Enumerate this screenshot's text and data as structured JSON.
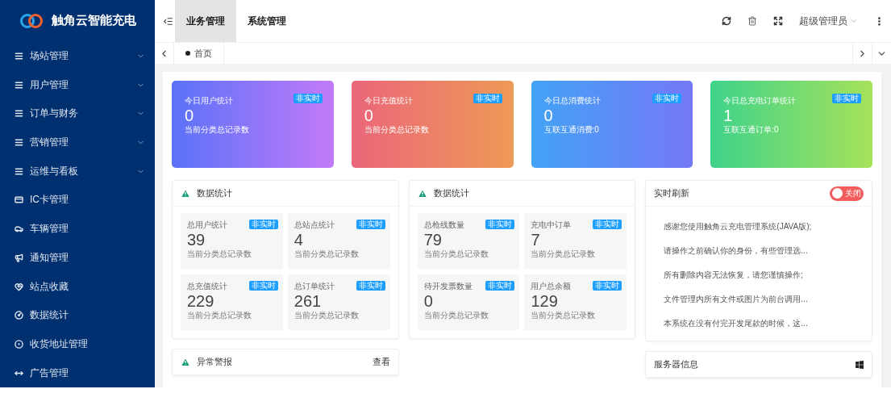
{
  "brand": {
    "name": "触角云智能充电"
  },
  "sidebar": {
    "items": [
      {
        "label": "场站管理",
        "kind": "group"
      },
      {
        "label": "用户管理",
        "kind": "group"
      },
      {
        "label": "订单与财务",
        "kind": "group"
      },
      {
        "label": "营销管理",
        "kind": "group"
      },
      {
        "label": "运维与看板",
        "kind": "group"
      },
      {
        "label": "IC卡管理",
        "kind": "link"
      },
      {
        "label": "车辆管理",
        "kind": "link"
      },
      {
        "label": "通知管理",
        "kind": "link"
      },
      {
        "label": "站点收藏",
        "kind": "link"
      },
      {
        "label": "数据统计",
        "kind": "link"
      },
      {
        "label": "收货地址管理",
        "kind": "link"
      },
      {
        "label": "广告管理",
        "kind": "link"
      }
    ]
  },
  "header": {
    "tabs": [
      {
        "label": "业务管理",
        "selected": true
      },
      {
        "label": "系统管理",
        "selected": false
      }
    ],
    "user": "超级管理员"
  },
  "tagbar": {
    "tags": [
      {
        "label": "首页",
        "selected": true
      }
    ]
  },
  "today_cards": [
    {
      "title": "今日用户统计",
      "badge": "非实时",
      "value": "0",
      "note": "当前分类总记录数"
    },
    {
      "title": "今日充值统计",
      "badge": "非实时",
      "value": "0",
      "note": "当前分类总记录数"
    },
    {
      "title": "今日总消费统计",
      "badge": "非实时",
      "value": "0",
      "note": "互联互通消费:0"
    },
    {
      "title": "今日总充电订单统计",
      "badge": "非实时",
      "value": "1",
      "note": "互联互通订单:0"
    }
  ],
  "stat_panels": [
    {
      "title": "数据统计",
      "tiles": [
        {
          "title": "总用户统计",
          "badge": "非实时",
          "value": "39",
          "note": "当前分类总记录数"
        },
        {
          "title": "总站点统计",
          "badge": "非实时",
          "value": "4",
          "note": "当前分类总记录数"
        },
        {
          "title": "总充值统计",
          "badge": "非实时",
          "value": "229",
          "note": "当前分类总记录数"
        },
        {
          "title": "总订单统计",
          "badge": "非实时",
          "value": "261",
          "note": "当前分类总记录数"
        }
      ]
    },
    {
      "title": "数据统计",
      "tiles": [
        {
          "title": "总枪线数量",
          "badge": "非实时",
          "value": "79",
          "note": "当前分类总记录数"
        },
        {
          "title": "充电中订单",
          "badge": "非实时",
          "value": "7",
          "note": "当前分类总记录数"
        },
        {
          "title": "待开发票数量",
          "badge": "非实时",
          "value": "0",
          "note": "当前分类总记录数"
        },
        {
          "title": "用户总余额",
          "badge": "非实时",
          "value": "129",
          "note": "当前分类总记录数"
        }
      ]
    }
  ],
  "alerts": {
    "title": "异常警报",
    "action": "查看"
  },
  "realtime": {
    "title": "实时刷新",
    "toggle": {
      "label": "关闭",
      "on": false
    },
    "notices": [
      "感谢您使用触角云充电管理系统(JAVA版);",
      "请操作之前确认你的身份，有些管理选...",
      "所有删除内容无法恢复，请您谨慎操作;",
      "文件管理内所有文件或图片为前台调用...",
      "本系统在没有付完开发尾款的时候，这..."
    ]
  },
  "server": {
    "title": "服务器信息"
  }
}
